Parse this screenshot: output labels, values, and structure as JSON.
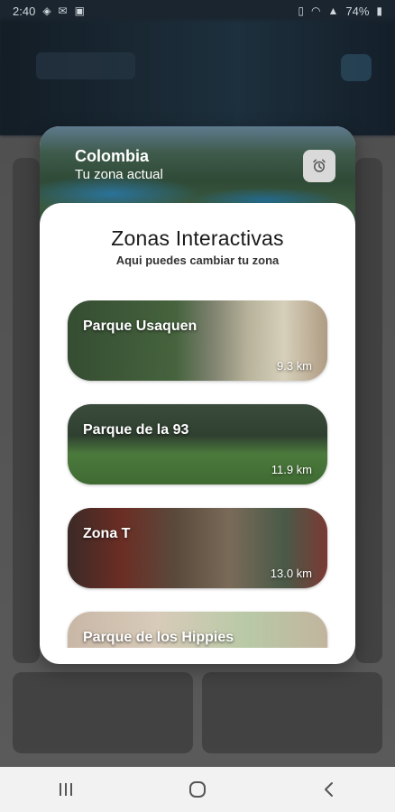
{
  "status_bar": {
    "time": "2:40",
    "right_text": "74%"
  },
  "modal": {
    "hero": {
      "title": "Colombia",
      "subtitle": "Tu zona actual"
    },
    "alarm_icon": "alarm-clock-icon",
    "heading": "Zonas Interactivas",
    "subheading": "Aqui puedes cambiar tu zona",
    "zones": [
      {
        "name": "Parque Usaquen",
        "distance": "9.3 km"
      },
      {
        "name": "Parque de la 93",
        "distance": "11.9 km"
      },
      {
        "name": "Zona T",
        "distance": "13.0 km"
      },
      {
        "name": "Parque de los Hippies",
        "distance": ""
      }
    ]
  },
  "navigation": {
    "recents_icon": "recents-icon",
    "home_icon": "home-icon",
    "back_icon": "back-icon"
  }
}
